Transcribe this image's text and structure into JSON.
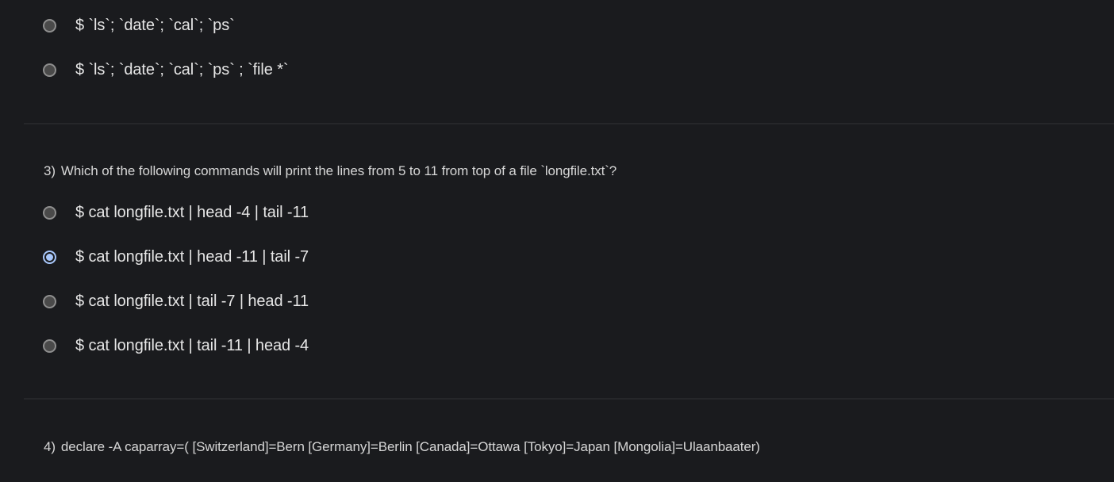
{
  "q2": {
    "options": [
      {
        "label": "$ `ls`; `date`; `cal`; `ps`",
        "selected": false
      },
      {
        "label": "$ `ls`; `date`; `cal`; `ps` ; `file *`",
        "selected": false
      }
    ]
  },
  "q3": {
    "number": "3)",
    "text": "Which of the following commands will print the lines from 5 to 11 from top of a file `longfile.txt`?",
    "options": [
      {
        "label": "$ cat longfile.txt | head -4 | tail -11",
        "selected": false
      },
      {
        "label": "$ cat longfile.txt | head -11 | tail -7",
        "selected": true
      },
      {
        "label": "$ cat longfile.txt | tail -7 | head -11",
        "selected": false
      },
      {
        "label": "$ cat longfile.txt | tail -11 | head -4",
        "selected": false
      }
    ]
  },
  "q4": {
    "number": "4)",
    "text": "declare -A caparray=( [Switzerland]=Bern [Germany]=Berlin [Canada]=Ottawa [Tokyo]=Japan [Mongolia]=Ulaanbaater)"
  },
  "colors": {
    "background": "#1a1b1e",
    "accent": "#a8c7fa",
    "divider": "#26272a"
  }
}
